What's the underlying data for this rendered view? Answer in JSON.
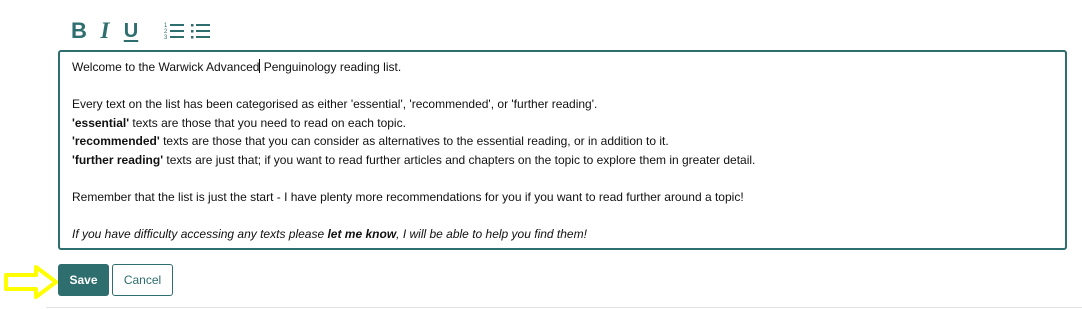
{
  "toolbar": {
    "bold_label": "B",
    "italic_label": "I",
    "underline_label": "U",
    "icons": [
      "bold-icon",
      "italic-icon",
      "underline-icon",
      "numbered-list-icon",
      "bulleted-list-icon"
    ]
  },
  "editor": {
    "line1_before_caret": "Welcome to the Warwick Advanced",
    "line1_after_caret": " Penguinology reading list.",
    "line2": "Every text on the list has been categorised as either 'essential', 'recommended', or 'further reading'.",
    "line3_bold": "'essential'",
    "line3_rest": " texts are those that you need to read on each topic.",
    "line4_bold": "'recommended'",
    "line4_rest": " texts are those that you can consider as alternatives to the essential reading, or in addition to it.",
    "line5_bold": "'further reading'",
    "line5_rest": " texts are just that; if you want to read further articles and chapters on the topic to explore them in greater detail.",
    "line6": "Remember that the list is just the start - I have plenty more recommendations for you if you want to read further around a topic!",
    "line7_before": "If you have difficulty accessing any texts please ",
    "line7_bold": "let me know",
    "line7_after": ", I will be able to help you find them!"
  },
  "actions": {
    "save_label": "Save",
    "cancel_label": "Cancel"
  },
  "colors": {
    "accent": "#2e6e6e",
    "highlight_arrow": "#ffff00"
  }
}
